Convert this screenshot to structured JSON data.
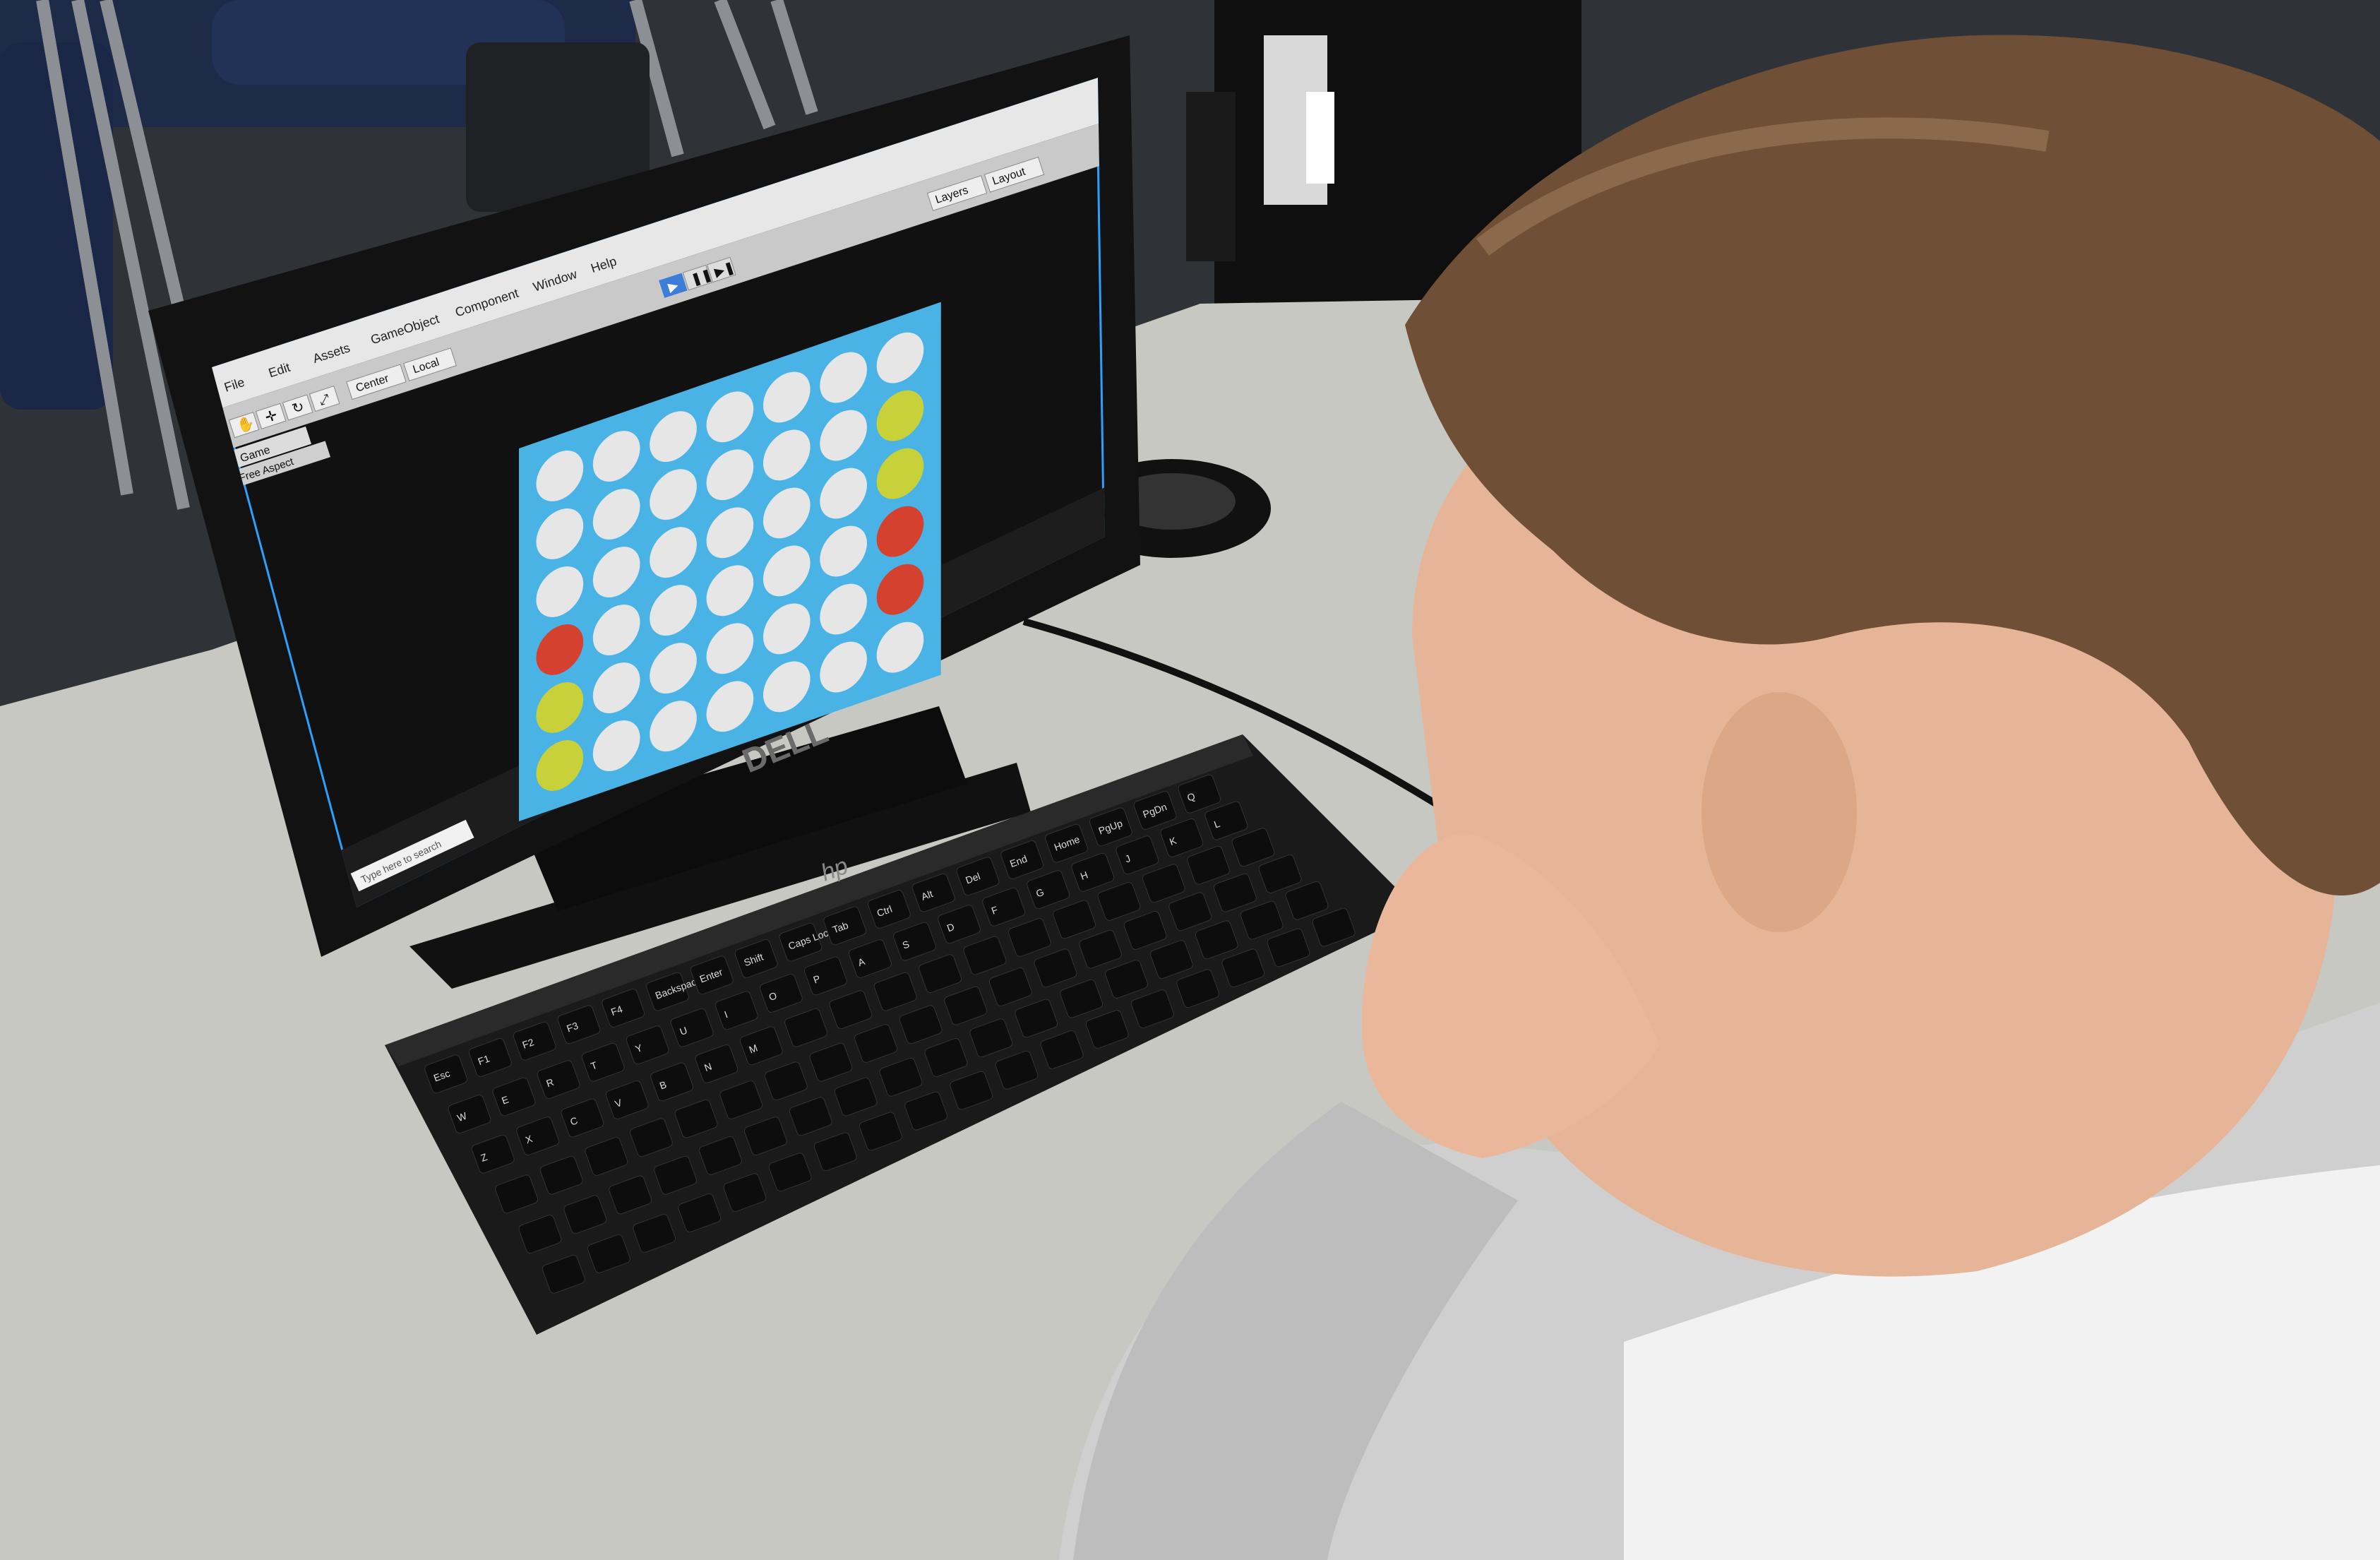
{
  "scene": {
    "description_colors": {
      "desk": "#c9c9c4",
      "wall": "#d9d6cf",
      "board": "#4ab3e6",
      "empty_cell": "#e6e6e6",
      "red_piece": "#d5412f",
      "yellow_piece": "#c9d13a",
      "editor_bg": "#101010",
      "monitor_frame": "#151515",
      "keyboard": "#1c1c1c",
      "hair": "#6b4e33",
      "skin": "#e8b89a",
      "shirt": "#d8d8d8"
    }
  },
  "unity_editor": {
    "menu": [
      "File",
      "Edit",
      "Assets",
      "GameObject",
      "Component",
      "Window",
      "Help"
    ],
    "pivot_buttons": [
      "Center",
      "Local"
    ],
    "play_controls": [
      "play-icon",
      "pause-icon",
      "step-icon"
    ],
    "panel_tab": "Game",
    "aspect": "Free Aspect",
    "top_right_buttons": [
      "Layers",
      "Layout"
    ]
  },
  "connect_four": {
    "columns": 7,
    "rows": 6,
    "pieces": [
      {
        "col": 0,
        "row": 3,
        "color": "red"
      },
      {
        "col": 0,
        "row": 4,
        "color": "yellow"
      },
      {
        "col": 0,
        "row": 5,
        "color": "yellow"
      },
      {
        "col": 6,
        "row": 1,
        "color": "yellow"
      },
      {
        "col": 6,
        "row": 2,
        "color": "yellow"
      },
      {
        "col": 6,
        "row": 3,
        "color": "red"
      },
      {
        "col": 6,
        "row": 4,
        "color": "red"
      }
    ]
  },
  "keyboard": {
    "brand": "hp",
    "key_labels": [
      "Esc",
      "F1",
      "F2",
      "F3",
      "F4",
      "Backspace",
      "Enter",
      "Shift",
      "Caps Lock",
      "Tab",
      "Ctrl",
      "Alt",
      "Del",
      "End",
      "Home",
      "PgUp",
      "PgDn",
      "Q",
      "W",
      "E",
      "R",
      "T",
      "Y",
      "U",
      "I",
      "O",
      "P",
      "A",
      "S",
      "D",
      "F",
      "G",
      "H",
      "J",
      "K",
      "L",
      "Z",
      "X",
      "C",
      "V",
      "B",
      "N",
      "M"
    ]
  },
  "monitor": {
    "brand": "DELL"
  },
  "taskbar": {
    "search_placeholder": "Type here to search"
  }
}
